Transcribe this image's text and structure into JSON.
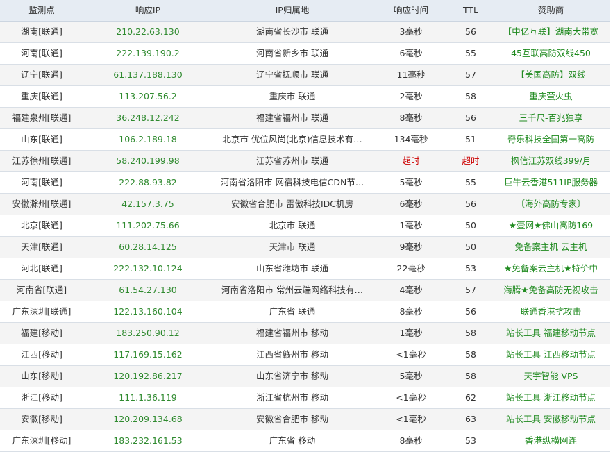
{
  "columns": [
    "监测点",
    "响应IP",
    "IP归属地",
    "响应时间",
    "TTL",
    "赞助商"
  ],
  "rows": [
    {
      "node": "湖南[联通]",
      "ip": "210.22.63.130",
      "location": "湖南省长沙市 联通",
      "time": "3毫秒",
      "ttl": "56",
      "sponsor": "【中亿互联】湖南大带宽",
      "timeout": false
    },
    {
      "node": "河南[联通]",
      "ip": "222.139.190.2",
      "location": "河南省新乡市 联通",
      "time": "6毫秒",
      "ttl": "55",
      "sponsor": "45互联高防双线450",
      "timeout": false
    },
    {
      "node": "辽宁[联通]",
      "ip": "61.137.188.130",
      "location": "辽宁省抚顺市 联通",
      "time": "11毫秒",
      "ttl": "57",
      "sponsor": "【美国高防】双线",
      "timeout": false
    },
    {
      "node": "重庆[联通]",
      "ip": "113.207.56.2",
      "location": "重庆市 联通",
      "time": "2毫秒",
      "ttl": "58",
      "sponsor": "重庆萤火虫",
      "timeout": false
    },
    {
      "node": "福建泉州[联通]",
      "ip": "36.248.12.242",
      "location": "福建省福州市 联通",
      "time": "8毫秒",
      "ttl": "56",
      "sponsor": "三千尺-百兆独享",
      "timeout": false
    },
    {
      "node": "山东[联通]",
      "ip": "106.2.189.18",
      "location": "北京市 优位风尚(北京)信息技术有…",
      "time": "134毫秒",
      "ttl": "51",
      "sponsor": "奇乐科技全国第一高防",
      "timeout": false
    },
    {
      "node": "江苏徐州[联通]",
      "ip": "58.240.199.98",
      "location": "江苏省苏州市 联通",
      "time": "超时",
      "ttl": "超时",
      "sponsor": "枫信江苏双线399/月",
      "timeout": true
    },
    {
      "node": "河南[联通]",
      "ip": "222.88.93.82",
      "location": "河南省洛阳市 网宿科技电信CDN节…",
      "time": "5毫秒",
      "ttl": "55",
      "sponsor": "巨牛云香港511IP服务器",
      "timeout": false
    },
    {
      "node": "安徽滁州[联通]",
      "ip": "42.157.3.75",
      "location": "安徽省合肥市 雷傲科技IDC机房",
      "time": "6毫秒",
      "ttl": "56",
      "sponsor": "〔海外高防专家〕",
      "timeout": false
    },
    {
      "node": "北京[联通]",
      "ip": "111.202.75.66",
      "location": "北京市 联通",
      "time": "1毫秒",
      "ttl": "50",
      "sponsor": "★壹网★佛山高防169",
      "timeout": false
    },
    {
      "node": "天津[联通]",
      "ip": "60.28.14.125",
      "location": "天津市 联通",
      "time": "9毫秒",
      "ttl": "50",
      "sponsor": "免备案主机 云主机",
      "timeout": false
    },
    {
      "node": "河北[联通]",
      "ip": "222.132.10.124",
      "location": "山东省潍坊市 联通",
      "time": "22毫秒",
      "ttl": "53",
      "sponsor": "★免备案云主机★特价中",
      "timeout": false
    },
    {
      "node": "河南省[联通]",
      "ip": "61.54.27.130",
      "location": "河南省洛阳市 常州云端网络科技有…",
      "time": "4毫秒",
      "ttl": "57",
      "sponsor": "海腾★免备高防无视攻击",
      "timeout": false
    },
    {
      "node": "广东深圳[联通]",
      "ip": "122.13.160.104",
      "location": "广东省 联通",
      "time": "8毫秒",
      "ttl": "56",
      "sponsor": "联通香港抗攻击",
      "timeout": false
    },
    {
      "node": "福建[移动]",
      "ip": "183.250.90.12",
      "location": "福建省福州市 移动",
      "time": "1毫秒",
      "ttl": "58",
      "sponsor": "站长工具 福建移动节点",
      "timeout": false
    },
    {
      "node": "江西[移动]",
      "ip": "117.169.15.162",
      "location": "江西省赣州市 移动",
      "time": "<1毫秒",
      "ttl": "58",
      "sponsor": "站长工具 江西移动节点",
      "timeout": false
    },
    {
      "node": "山东[移动]",
      "ip": "120.192.86.217",
      "location": "山东省济宁市 移动",
      "time": "5毫秒",
      "ttl": "58",
      "sponsor": "天宇智能 VPS",
      "timeout": false
    },
    {
      "node": "浙江[移动]",
      "ip": "111.1.36.119",
      "location": "浙江省杭州市 移动",
      "time": "<1毫秒",
      "ttl": "62",
      "sponsor": "站长工具 浙江移动节点",
      "timeout": false
    },
    {
      "node": "安徽[移动]",
      "ip": "120.209.134.68",
      "location": "安徽省合肥市 移动",
      "time": "<1毫秒",
      "ttl": "63",
      "sponsor": "站长工具 安徽移动节点",
      "timeout": false
    },
    {
      "node": "广东深圳[移动]",
      "ip": "183.232.161.53",
      "location": "广东省 移动",
      "time": "8毫秒",
      "ttl": "53",
      "sponsor": "香港纵横网连",
      "timeout": false
    }
  ],
  "colors": {
    "ip_text": "#2f8a2f",
    "sponsor_link": "#1f8a1f",
    "timeout": "#cc0000",
    "header_bg": "#e6ecf3",
    "row_alt_bg": "#f4f4f4"
  }
}
